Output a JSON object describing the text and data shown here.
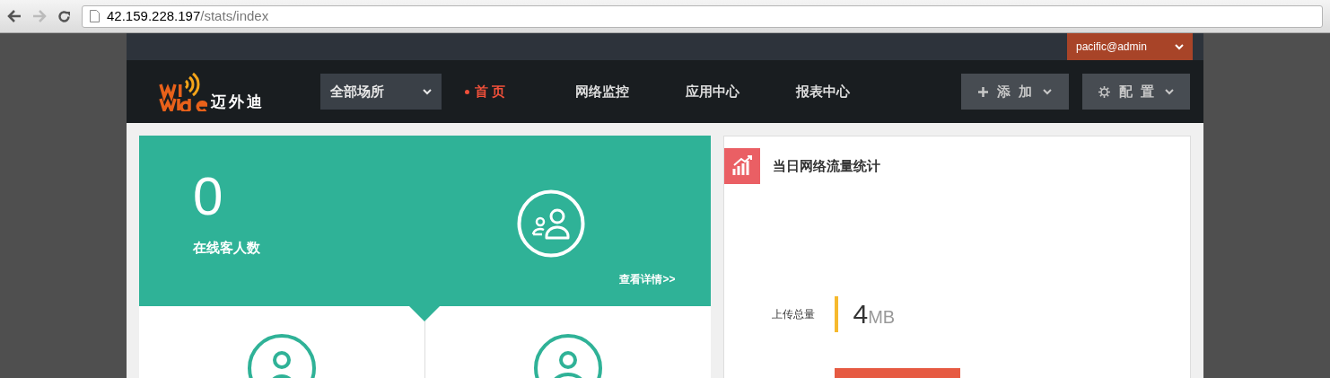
{
  "browser": {
    "url_host": "42.159.228.197",
    "url_path": "/stats/index"
  },
  "topbar": {
    "user": "pacific@admin"
  },
  "header": {
    "logo_text": "迈外迪",
    "venue_select": "全部场所",
    "nav": [
      {
        "label": "首 页",
        "selected": true
      },
      {
        "label": "网络监控",
        "selected": false
      },
      {
        "label": "应用中心",
        "selected": false
      },
      {
        "label": "报表中心",
        "selected": false
      }
    ],
    "actions": [
      {
        "kind": "add",
        "label": "添 加"
      },
      {
        "kind": "config",
        "label": "配 置"
      }
    ]
  },
  "online_card": {
    "value": "0",
    "label": "在线客人数",
    "link": "查看详情>>"
  },
  "traffic_card": {
    "title": "当日网络流量统计",
    "upload_label": "上传总量",
    "upload_value": "4",
    "upload_unit": "MB"
  }
}
